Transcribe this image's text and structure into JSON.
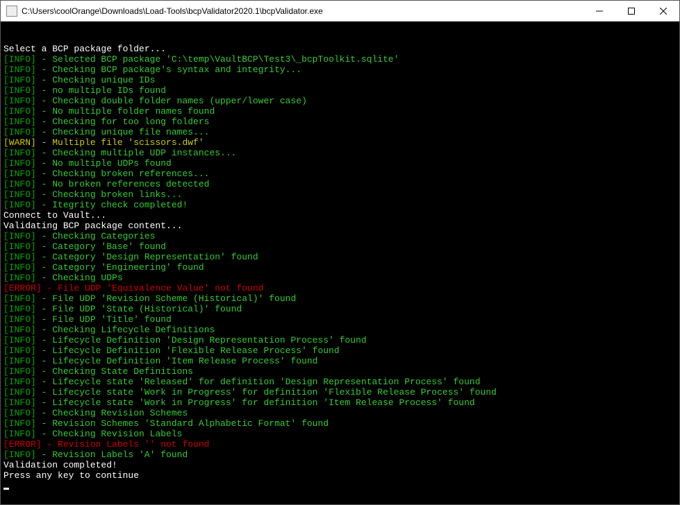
{
  "titlebar": {
    "path": "C:\\Users\\coolOrange\\Downloads\\Load-Tools\\bcpValidator2020.1\\bcpValidator.exe"
  },
  "lines": [
    {
      "type": "white",
      "text": "Select a BCP package folder..."
    },
    {
      "type": "info",
      "text": "Selected BCP package 'C:\\temp\\VaultBCP\\Test3\\_bcpToolkit.sqlite'"
    },
    {
      "type": "info",
      "text": "Checking BCP package's syntax and integrity..."
    },
    {
      "type": "info",
      "text": "Checking unique IDs"
    },
    {
      "type": "info",
      "text": "no multiple IDs found"
    },
    {
      "type": "info",
      "text": "Checking double folder names (upper/lower case)"
    },
    {
      "type": "info",
      "text": "No multiple folder names found"
    },
    {
      "type": "info",
      "text": "Checking for too long folders"
    },
    {
      "type": "info",
      "text": "Checking unique file names..."
    },
    {
      "type": "warn",
      "text": "Multiple file 'scissors.dwf'"
    },
    {
      "type": "info",
      "text": "Checking multiple UDP instances..."
    },
    {
      "type": "info",
      "text": "No multiple UDPs found"
    },
    {
      "type": "info",
      "text": "Checking broken references..."
    },
    {
      "type": "info",
      "text": "No broken references detected"
    },
    {
      "type": "info",
      "text": "Checking broken links..."
    },
    {
      "type": "info",
      "text": "Itegrity check completed!"
    },
    {
      "type": "white",
      "text": "Connect to Vault..."
    },
    {
      "type": "white",
      "text": "Validating BCP package content..."
    },
    {
      "type": "info",
      "text": "Checking Categories"
    },
    {
      "type": "info",
      "text": "Category 'Base' found"
    },
    {
      "type": "info",
      "text": "Category 'Design Representation' found"
    },
    {
      "type": "info",
      "text": "Category 'Engineering' found"
    },
    {
      "type": "info",
      "text": "Checking UDPs"
    },
    {
      "type": "error",
      "text": "File UDP 'Equivalence Value' not found"
    },
    {
      "type": "info",
      "text": "File UDP 'Revision Scheme (Historical)' found"
    },
    {
      "type": "info",
      "text": "File UDP 'State (Historical)' found"
    },
    {
      "type": "info",
      "text": "File UDP 'Title' found"
    },
    {
      "type": "info",
      "text": "Checking Lifecycle Definitions"
    },
    {
      "type": "info",
      "text": "Lifecycle Definition 'Design Representation Process' found"
    },
    {
      "type": "info",
      "text": "Lifecycle Definition 'Flexible Release Process' found"
    },
    {
      "type": "info",
      "text": "Lifecycle Definition 'Item Release Process' found"
    },
    {
      "type": "info",
      "text": "Checking State Definitions"
    },
    {
      "type": "info",
      "text": "Lifecycle state 'Released' for definition 'Design Representation Process' found"
    },
    {
      "type": "info",
      "text": "Lifecycle state 'Work in Progress' for definition 'Flexible Release Process' found"
    },
    {
      "type": "info",
      "text": "Lifecycle state 'Work in Progress' for definition 'Item Release Process' found"
    },
    {
      "type": "info",
      "text": "Checking Revision Schemes"
    },
    {
      "type": "info",
      "text": "Revision Schemes 'Standard Alphabetic Format' found"
    },
    {
      "type": "info",
      "text": "Checking Revision Labels"
    },
    {
      "type": "error",
      "text": "Revision Labels '' not found"
    },
    {
      "type": "info",
      "text": "Revision Labels 'A' found"
    },
    {
      "type": "white",
      "text": "Validation completed!"
    },
    {
      "type": "white",
      "text": "Press any key to continue"
    }
  ],
  "labels": {
    "info": "[INFO]",
    "warn": "[WARN]",
    "error": "[ERROR]",
    "sep": " - "
  }
}
